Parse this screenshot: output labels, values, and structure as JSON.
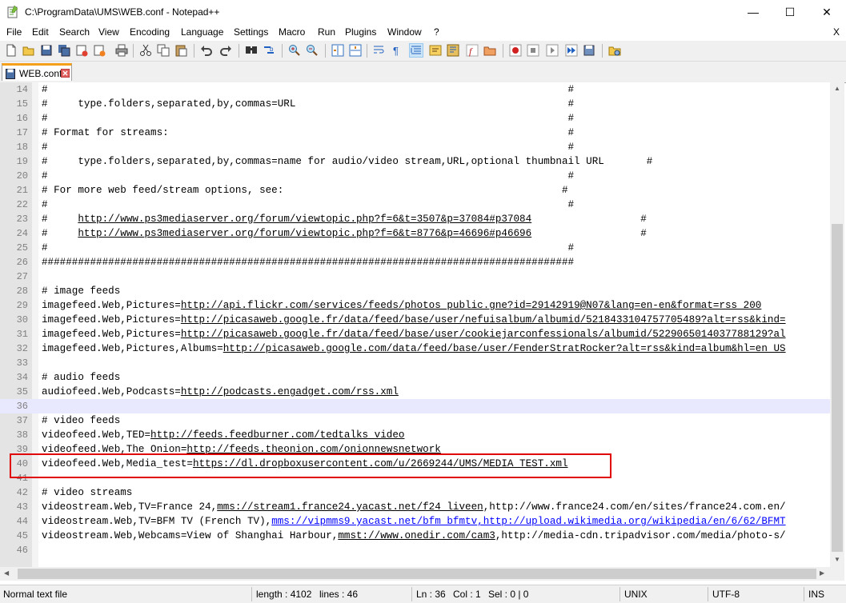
{
  "window": {
    "title": "C:\\ProgramData\\UMS\\WEB.conf - Notepad++",
    "minimize": "—",
    "maximize": "☐",
    "close": "✕"
  },
  "menu": {
    "items": [
      "File",
      "Edit",
      "Search",
      "View",
      "Encoding",
      "Language",
      "Settings",
      "Macro",
      "Run",
      "Plugins",
      "Window",
      "?"
    ],
    "close": "X"
  },
  "tab": {
    "label": "WEB.conf"
  },
  "editor": {
    "lines": [
      {
        "n": "14",
        "text": "#                                                                                      #"
      },
      {
        "n": "15",
        "text": "#     type.folders,separated,by,commas=URL                                             #"
      },
      {
        "n": "16",
        "text": "#                                                                                      #"
      },
      {
        "n": "17",
        "text": "# Format for streams:                                                                  #"
      },
      {
        "n": "18",
        "text": "#                                                                                      #"
      },
      {
        "n": "19",
        "text": "#     type.folders,separated,by,commas=name for audio/video stream,URL,optional thumbnail URL       #"
      },
      {
        "n": "20",
        "text": "#                                                                                      #"
      },
      {
        "n": "21",
        "text": "# For more web feed/stream options, see:                                              #"
      },
      {
        "n": "22",
        "text": "#                                                                                      #"
      },
      {
        "n": "23",
        "prefix": "#     ",
        "link": "http://www.ps3mediaserver.org/forum/viewtopic.php?f=6&t=3507&p=37084#p37084",
        "suffix": "                  #"
      },
      {
        "n": "24",
        "prefix": "#     ",
        "link": "http://www.ps3mediaserver.org/forum/viewtopic.php?f=6&t=8776&p=46696#p46696",
        "suffix": "                  #"
      },
      {
        "n": "25",
        "text": "#                                                                                      #"
      },
      {
        "n": "26",
        "text": "########################################################################################"
      },
      {
        "n": "27",
        "text": ""
      },
      {
        "n": "28",
        "text": "# image feeds"
      },
      {
        "n": "29",
        "prefix": "imagefeed.Web,Pictures=",
        "link": "http://api.flickr.com/services/feeds/photos_public.gne?id=29142919@N07&lang=en-en&format=rss_200"
      },
      {
        "n": "30",
        "prefix": "imagefeed.Web,Pictures=",
        "link": "http://picasaweb.google.fr/data/feed/base/user/nefuisalbum/albumid/5218433104757705489?alt=rss&kind="
      },
      {
        "n": "31",
        "prefix": "imagefeed.Web,Pictures=",
        "link": "http://picasaweb.google.fr/data/feed/base/user/cookiejarconfessionals/albumid/5229065014037788129?al"
      },
      {
        "n": "32",
        "prefix": "imagefeed.Web,Pictures,Albums=",
        "link": "http://picasaweb.google.com/data/feed/base/user/FenderStratRocker?alt=rss&kind=album&hl=en_US"
      },
      {
        "n": "33",
        "text": ""
      },
      {
        "n": "34",
        "text": "# audio feeds"
      },
      {
        "n": "35",
        "prefix": "audiofeed.Web,Podcasts=",
        "link": "http://podcasts.engadget.com/rss.xml"
      },
      {
        "n": "36",
        "text": "",
        "current": true
      },
      {
        "n": "37",
        "text": "# video feeds"
      },
      {
        "n": "38",
        "prefix": "videofeed.Web,TED=",
        "link": "http://feeds.feedburner.com/tedtalks_video"
      },
      {
        "n": "39",
        "prefix": "videofeed.Web,The Onion=",
        "link": "http://feeds.theonion.com/onionnewsnetwork"
      },
      {
        "n": "40",
        "prefix": "videofeed.Web,Media_test=",
        "link": "https://dl.dropboxusercontent.com/u/2669244/UMS/MEDIA_TEST.xml"
      },
      {
        "n": "41",
        "text": ""
      },
      {
        "n": "42",
        "text": "# video streams"
      },
      {
        "n": "43",
        "prefix": "videostream.Web,TV=France 24,",
        "link": "mms://stream1.france24.yacast.net/f24_liveen",
        "suffix": ",http://www.france24.com/en/sites/france24.com.en/"
      },
      {
        "n": "44",
        "prefix": "videostream.Web,TV=BFM TV (French TV),",
        "link": "mms://vipmms9.yacast.net/bfm_bfmtv",
        "suffix2": ",http://upload.wikimedia.org/wikipedia/en/6/62/BFMT",
        "blue": true
      },
      {
        "n": "45",
        "prefix": "videostream.Web,Webcams=View of Shanghai Harbour,",
        "link": "mmst://www.onedir.com/cam3",
        "suffix": ",http://media-cdn.tripadvisor.com/media/photo-s/"
      },
      {
        "n": "46",
        "text": ""
      }
    ]
  },
  "status": {
    "filetype": "Normal text file",
    "length": "length : 4102",
    "lines": "lines : 46",
    "ln": "Ln : 36",
    "col": "Col : 1",
    "sel": "Sel : 0 | 0",
    "eol": "UNIX",
    "encoding": "UTF-8",
    "mode": "INS"
  }
}
